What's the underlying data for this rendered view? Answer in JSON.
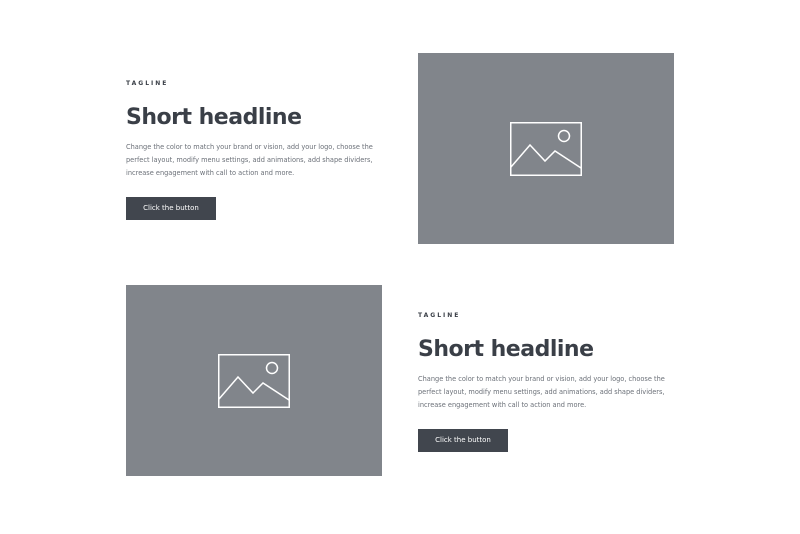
{
  "sections": [
    {
      "tagline": "TAGLINE",
      "headline": "Short headline",
      "body": "Change the color to match your brand or vision, add your logo, choose the perfect layout, modify menu settings, add animations, add shape dividers, increase engagement with call to action and more.",
      "button_label": "Click the button",
      "image_icon": "image-placeholder-icon"
    },
    {
      "tagline": "TAGLINE",
      "headline": "Short headline",
      "body": "Change the color to match your brand or vision, add your logo, choose the perfect layout, modify menu settings, add animations, add shape dividers, increase engagement with call to action and more.",
      "button_label": "Click the button",
      "image_icon": "image-placeholder-icon"
    }
  ],
  "colors": {
    "background": "#ffffff",
    "placeholder": "#81858b",
    "button": "#41464e",
    "heading": "#3a3f47",
    "body_text": "#6b7078"
  }
}
